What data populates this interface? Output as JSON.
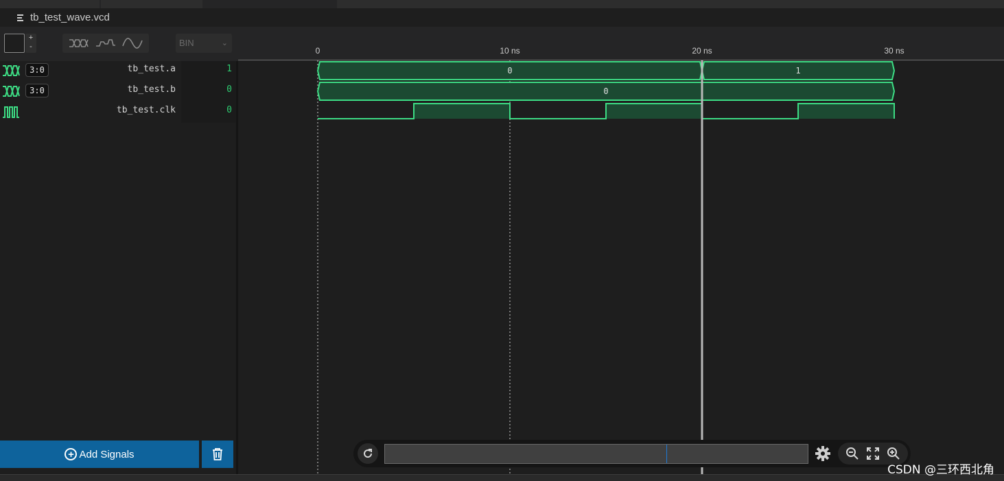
{
  "tab": {
    "title": "tb_test_wave.vcd",
    "icon": "file-lines-icon"
  },
  "toolbar": {
    "zoom_plus": "+",
    "zoom_minus": "-",
    "wave_options": [
      "bus-wave-icon",
      "step-wave-icon",
      "analog-wave-icon"
    ],
    "radix": "BIN"
  },
  "axis": {
    "ticks": [
      "0",
      "10 ns",
      "20 ns",
      "30 ns"
    ],
    "cursor_ns": 20
  },
  "signals": [
    {
      "icon": "bus-icon",
      "width": "3:0",
      "name": "tb_test.a",
      "value": "1"
    },
    {
      "icon": "bus-icon",
      "width": "3:0",
      "name": "tb_test.b",
      "value": "0"
    },
    {
      "icon": "clock-icon",
      "width": "",
      "name": "tb_test.clk",
      "value": "0"
    }
  ],
  "waves": {
    "a": [
      {
        "from": 0,
        "to": 20,
        "label": "0"
      },
      {
        "from": 20,
        "to": 30,
        "label": "1"
      }
    ],
    "b": [
      {
        "from": 0,
        "to": 30,
        "label": "0"
      }
    ],
    "clk": [
      {
        "t": 0,
        "v": 0
      },
      {
        "t": 5,
        "v": 1
      },
      {
        "t": 10,
        "v": 0
      },
      {
        "t": 15,
        "v": 1
      },
      {
        "t": 20,
        "v": 0
      },
      {
        "t": 25,
        "v": 1
      },
      {
        "t": 30,
        "v": 1
      }
    ]
  },
  "buttons": {
    "add_signals": "Add Signals",
    "delete": "trash-icon"
  },
  "nav": {
    "reload": "reload-icon",
    "settings": "gear-icon",
    "zoom_out": "zoom-out-icon",
    "fit": "fit-icon",
    "zoom_in": "zoom-in-icon"
  },
  "watermark": "CSDN @三环西北角",
  "colors": {
    "wave": "#3ddc84",
    "wave_fill": "#1c4a32",
    "accent_button": "#0e639c",
    "value_text": "#2ecc71"
  }
}
